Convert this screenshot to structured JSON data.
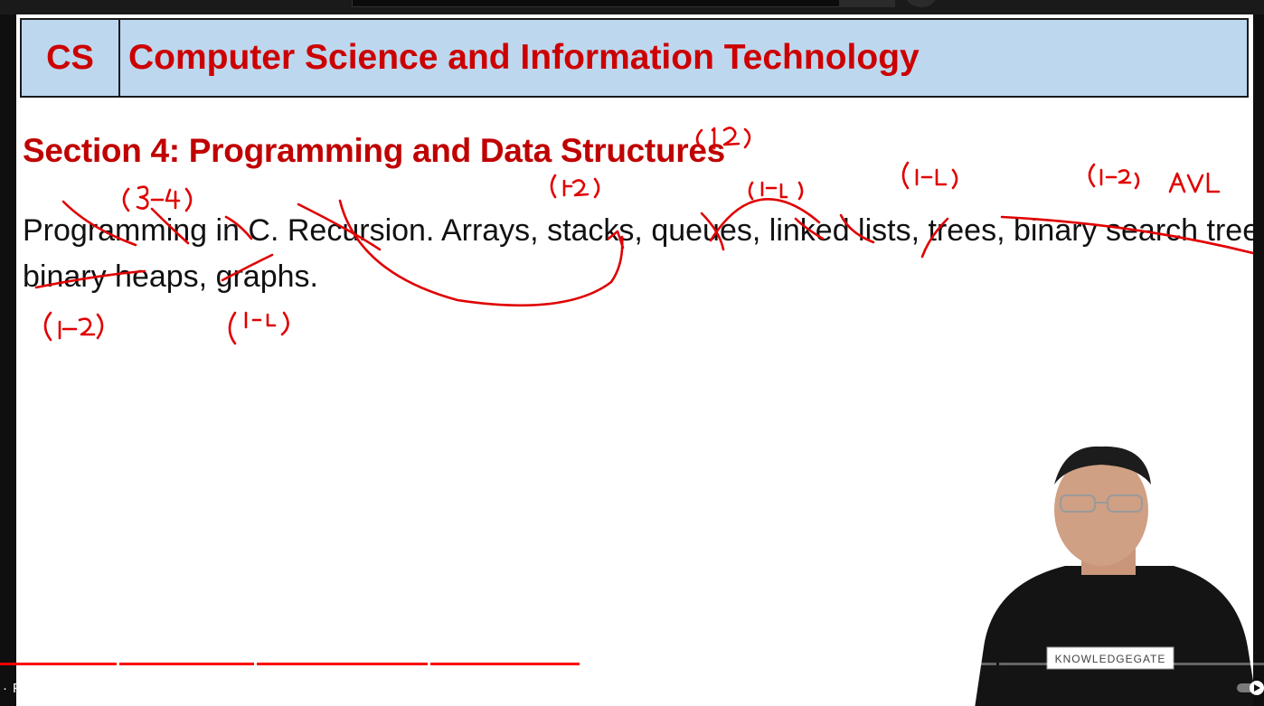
{
  "header": {
    "code": "CS",
    "title": "Computer Science and Information Technology"
  },
  "section_title": "Section 4: Programming and Data Structures",
  "syllabus": {
    "line1": "Programming in C. Recursion. Arrays, stacks, queues, linked lists, trees, binary search trees,",
    "line2": "binary heaps, graphs."
  },
  "annotations": [
    "(12)",
    "(3-4)",
    "(1-2)",
    "(1-2)",
    "(1-2)",
    "(1-2) AVL",
    "(1-2)",
    "(1-2)"
  ],
  "presenter": {
    "shirt_brand": "KNOWLEDGEGATE"
  },
  "player": {
    "chapter_separator": "·",
    "chapter_title": "Programming and Data Structures",
    "chapter_chevron": "›",
    "progress_played_fraction": 0.46
  },
  "colors": {
    "heading_red": "#cc0000",
    "header_fill": "#bdd7ee",
    "ink_red": "#e00000",
    "progress_red": "#ff0000"
  }
}
